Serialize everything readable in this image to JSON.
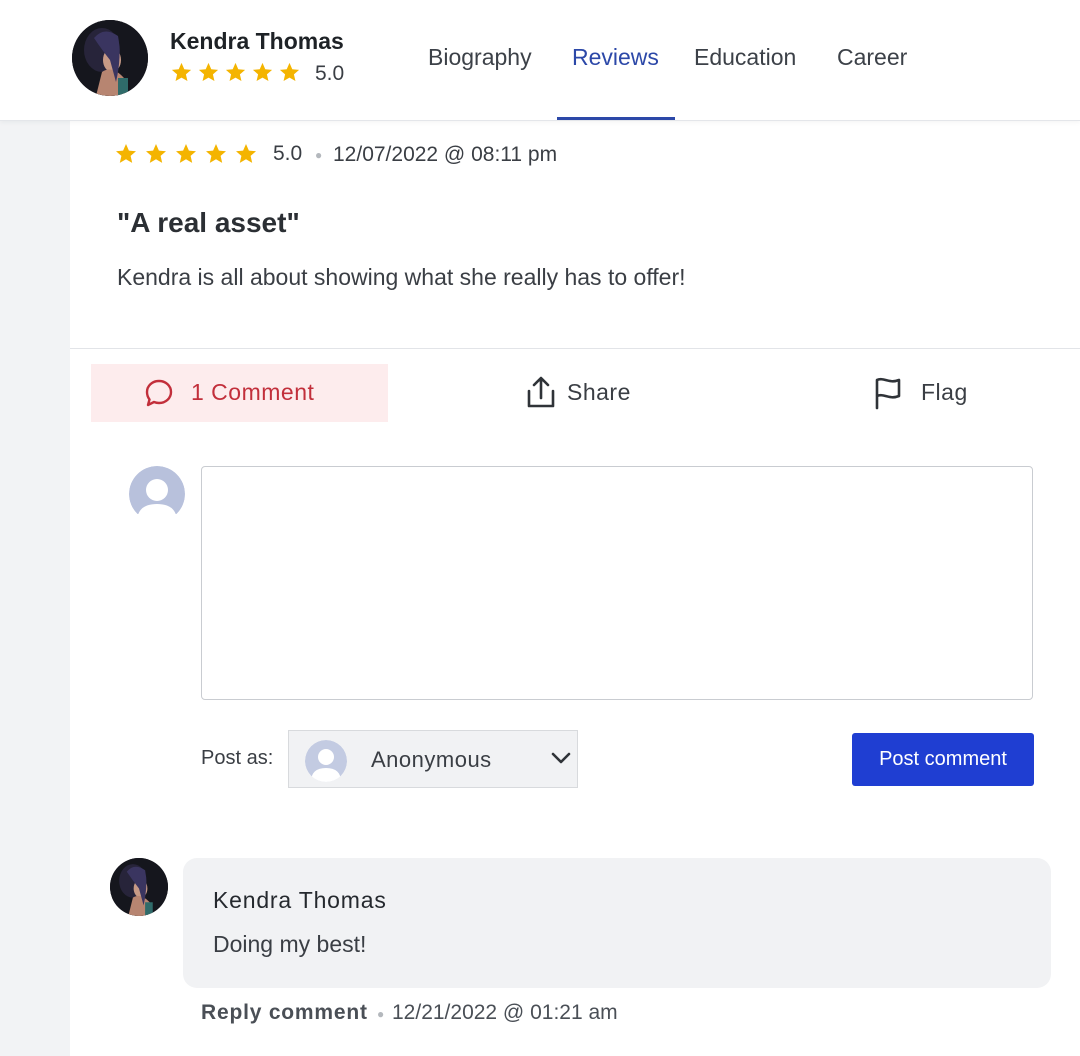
{
  "header": {
    "profile_name": "Kendra Thomas",
    "rating": "5.0",
    "star_count": 5,
    "star_color": "#f4b400",
    "tabs": [
      {
        "label": "Biography",
        "active": false
      },
      {
        "label": "Reviews",
        "active": true
      },
      {
        "label": "Education",
        "active": false
      },
      {
        "label": "Career",
        "active": false
      }
    ]
  },
  "review": {
    "rating": "5.0",
    "date": "12/07/2022 @ 08:11 pm",
    "title": "\"A real asset\"",
    "body": "Kendra is all about showing what she really has to offer!"
  },
  "actions": {
    "comment_label": "1 Comment",
    "share_label": "Share",
    "flag_label": "Flag",
    "accent_color": "#c22f3b"
  },
  "composer": {
    "comment_value": "",
    "post_as_label": "Post as:",
    "post_as_value": "Anonymous",
    "post_button_label": "Post comment",
    "button_color": "#1f3ed2"
  },
  "comments": [
    {
      "author": "Kendra Thomas",
      "text": "Doing my best!",
      "reply_label": "Reply comment",
      "date": "12/21/2022 @ 01:21 am"
    }
  ]
}
